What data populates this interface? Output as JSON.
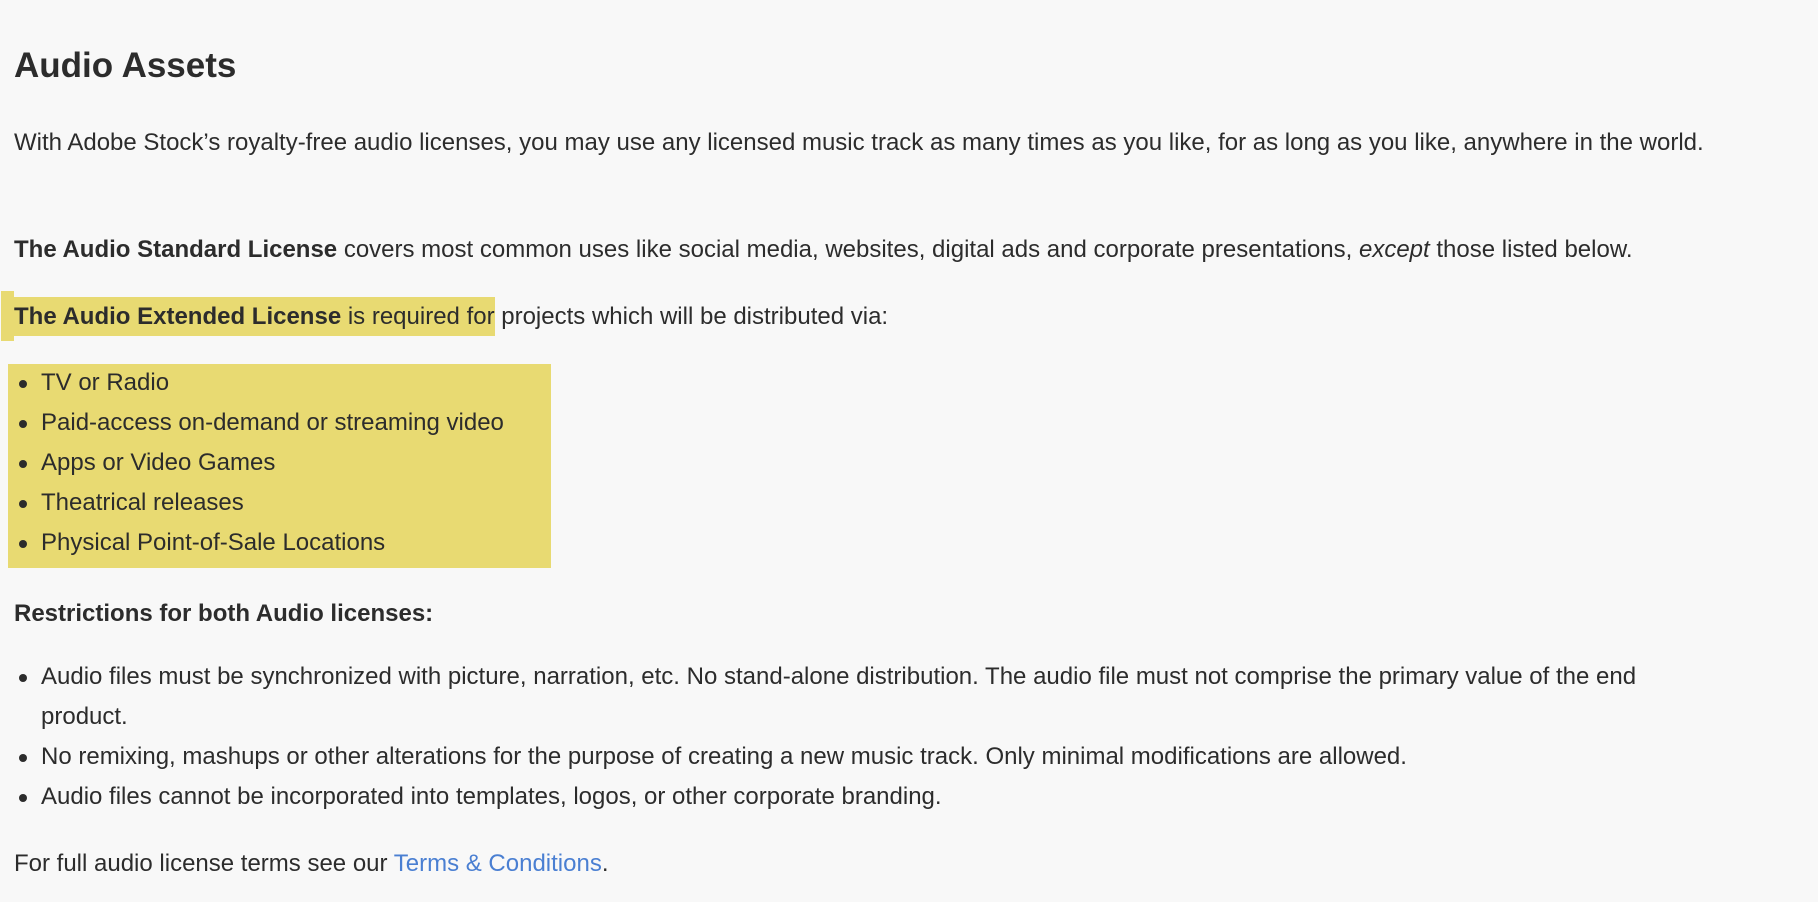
{
  "heading": "Audio Assets",
  "intro": "With Adobe Stock’s royalty-free audio licenses, you may use any licensed music track as many times as you like, for as long as you like, anywhere in the world.",
  "standard": {
    "bold": "The Audio Standard License",
    "text_before_italic": " covers most common uses like social media, websites, digital ads and corporate presentations, ",
    "italic": "except",
    "text_after_italic": " those listed below."
  },
  "extended": {
    "bold": "The Audio Extended License",
    "highlighted_text": " is required for",
    "rest": " projects which will be distributed via:",
    "items": [
      "TV or Radio",
      "Paid-access on-demand or streaming video",
      "Apps or Video Games",
      "Theatrical releases",
      "Physical Point-of-Sale Locations"
    ]
  },
  "restrictions": {
    "title": "Restrictions for both Audio licenses:",
    "items": [
      "Audio files must be synchronized with picture, narration, etc. No stand-alone distribution. The audio file must not comprise the primary value of the end product.",
      "No remixing, mashups or other alterations for the purpose of creating a new music track. Only minimal modifications are allowed.",
      "Audio files cannot be incorporated into templates, logos, or other corporate branding."
    ]
  },
  "terms": {
    "before": "For full audio license terms see our ",
    "link": "Terms & Conditions",
    "after": "."
  },
  "colors": {
    "background": "#f8f8f8",
    "text": "#2c2c2c",
    "highlight": "#e8da72",
    "link": "#4a7fd2"
  }
}
